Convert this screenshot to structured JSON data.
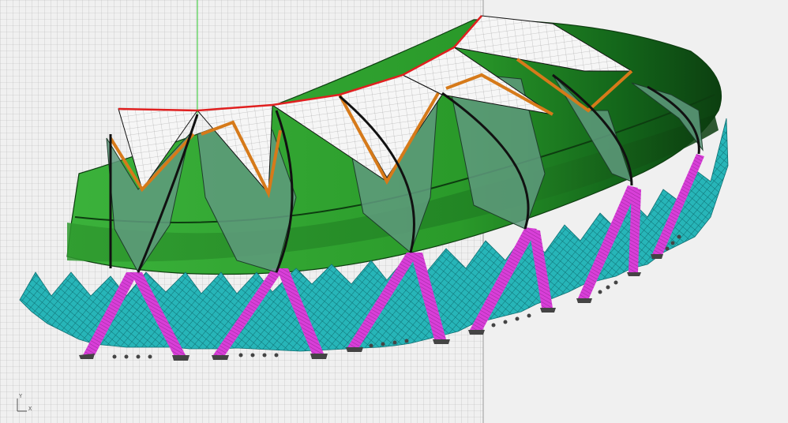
{
  "viewport": {
    "axis_x_label": "X",
    "axis_y_label": "Y"
  },
  "model": {
    "colors": {
      "background": "#f0f0f0",
      "grid_line": "#b8b8b8",
      "grid_border": "#9a9a9a",
      "roof_green": "#2fa52f",
      "roof_dark_green": "#0f5a12",
      "membrane_white": "#f4f4f4",
      "membrane_teal": "#5f9a7e",
      "facade_cyan": "#26b8bc",
      "column_magenta": "#d23ed2",
      "edge_red": "#e02020",
      "edge_orange": "#d67a1a",
      "edge_black": "#111111",
      "world_axis_green": "#2ecc2e"
    }
  }
}
